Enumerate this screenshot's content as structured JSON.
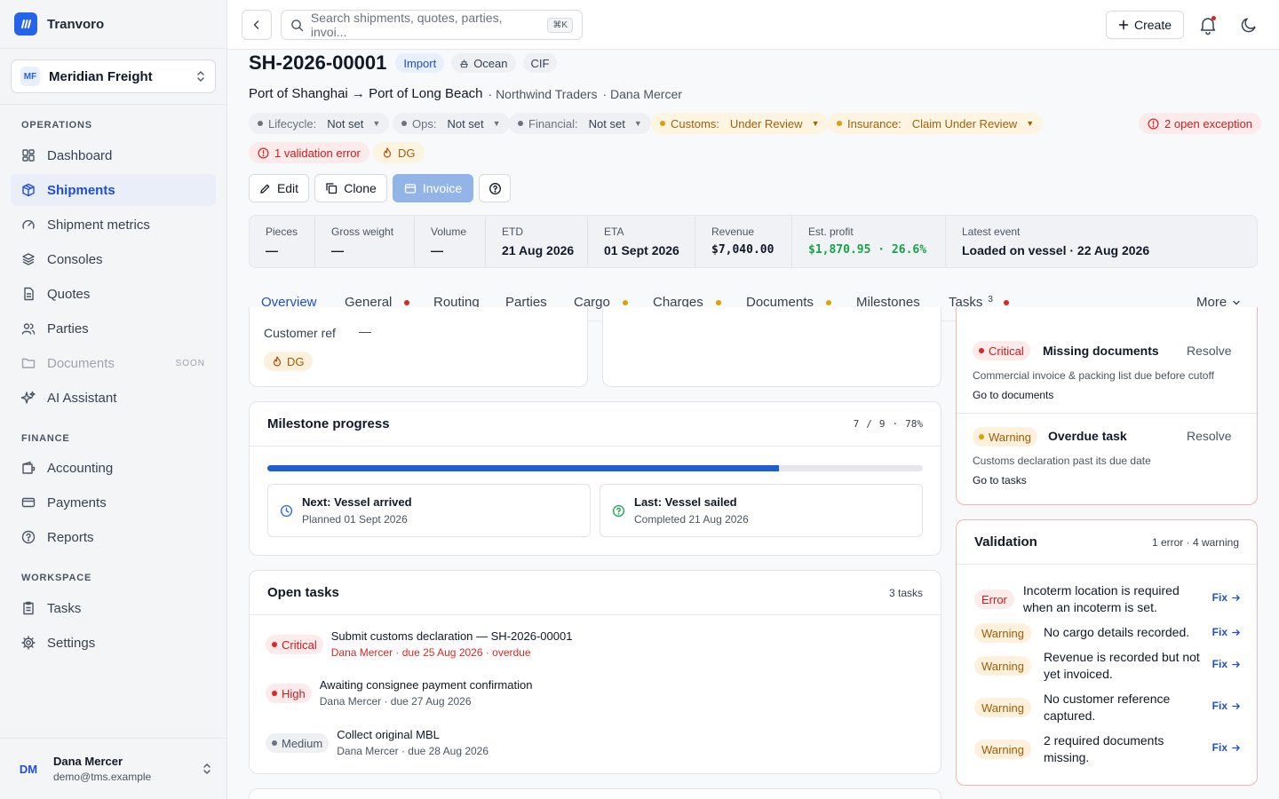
{
  "brand": {
    "name": "Tranvoro"
  },
  "org": {
    "initials": "MF",
    "name": "Meridian Freight"
  },
  "sidebar": {
    "operations_label": "OPERATIONS",
    "finance_label": "FINANCE",
    "workspace_label": "WORKSPACE",
    "items": [
      {
        "label": "Dashboard"
      },
      {
        "label": "Shipments"
      },
      {
        "label": "Shipment metrics"
      },
      {
        "label": "Consoles"
      },
      {
        "label": "Quotes"
      },
      {
        "label": "Parties"
      },
      {
        "label": "Documents",
        "tag": "SOON"
      },
      {
        "label": "AI Assistant"
      },
      {
        "label": "Accounting"
      },
      {
        "label": "Payments"
      },
      {
        "label": "Reports"
      },
      {
        "label": "Tasks"
      },
      {
        "label": "Settings"
      }
    ]
  },
  "user": {
    "initials": "DM",
    "name": "Dana Mercer",
    "email": "demo@tms.example"
  },
  "topbar": {
    "search_placeholder": "Search shipments, quotes, parties, invoi...",
    "shortcut": "⌘K",
    "create_label": "Create"
  },
  "shipment": {
    "id": "SH-2026-00001",
    "direction": "Import",
    "mode": "Ocean",
    "incoterm": "CIF",
    "route": "Port of Shanghai → Port of Long Beach",
    "customer": "· Northwind Traders",
    "owner": "· Dana Mercer",
    "statuses": [
      {
        "label": "Lifecycle:",
        "value": "Not set"
      },
      {
        "label": "Ops:",
        "value": "Not set"
      },
      {
        "label": "Financial:",
        "value": "Not set"
      },
      {
        "label": "Customs:",
        "value": "Under Review"
      },
      {
        "label": "Insurance:",
        "value": "Claim Under Review"
      }
    ],
    "exceptions": "2 open exception",
    "validation_error": "1 validation error",
    "dg": "DG"
  },
  "actions": {
    "edit": "Edit",
    "clone": "Clone",
    "invoice": "Invoice"
  },
  "stats": [
    {
      "label": "Pieces",
      "value": "—"
    },
    {
      "label": "Gross weight",
      "value": "—"
    },
    {
      "label": "Volume",
      "value": "—"
    },
    {
      "label": "ETD",
      "value": "21 Aug 2026"
    },
    {
      "label": "ETA",
      "value": "01 Sept 2026"
    },
    {
      "label": "Revenue",
      "value": "$7,040.00"
    },
    {
      "label": "Est. profit",
      "value": "$1,870.95 · 26.6%"
    },
    {
      "label": "Latest event",
      "value": "Loaded on vessel · 22 Aug 2026"
    }
  ],
  "tabs": [
    {
      "label": "Overview"
    },
    {
      "label": "General"
    },
    {
      "label": "Routing"
    },
    {
      "label": "Parties"
    },
    {
      "label": "Cargo"
    },
    {
      "label": "Charges"
    },
    {
      "label": "Documents"
    },
    {
      "label": "Milestones"
    },
    {
      "label": "Tasks",
      "count": "3"
    },
    {
      "label": "More"
    }
  ],
  "summary": {
    "customer_ref_label": "Customer ref",
    "customer_ref_value": "—",
    "dg": "DG"
  },
  "milestones": {
    "title": "Milestone progress",
    "done": "7",
    "sep": "/",
    "total": "9",
    "dot": "·",
    "percent_label": "78%",
    "progress": 0.78,
    "next_title": "Next: Vessel arrived",
    "next_sub": "Planned 01 Sept 2026",
    "last_title": "Last: Vessel sailed",
    "last_sub": "Completed 21 Aug 2026"
  },
  "tasks": {
    "title": "Open tasks",
    "count": "3 tasks",
    "items": [
      {
        "priority": "Critical",
        "title": "Submit customs declaration — SH-2026-00001",
        "meta": "Dana Mercer · due 25 Aug 2026 · overdue"
      },
      {
        "priority": "High",
        "title": "Awaiting consignee payment confirmation",
        "meta": "Dana Mercer · due 27 Aug 2026"
      },
      {
        "priority": "Medium",
        "title": "Collect original MBL",
        "meta": "Dana Mercer · due 28 Aug 2026"
      }
    ]
  },
  "exceptions": {
    "items": [
      {
        "severity": "Critical",
        "title": "Missing documents",
        "action": "Resolve",
        "desc": "Commercial invoice & packing list due before cutoff",
        "link": "Go to documents"
      },
      {
        "severity": "Warning",
        "title": "Overdue task",
        "action": "Resolve",
        "desc": "Customs declaration past its due date",
        "link": "Go to tasks"
      }
    ]
  },
  "validation": {
    "title": "Validation",
    "summary": "1 error · 4 warning",
    "fix_label": "Fix",
    "items": [
      {
        "level": "Error",
        "text": "Incoterm location is required when an incoterm is set."
      },
      {
        "level": "Warning",
        "text": "No cargo details recorded."
      },
      {
        "level": "Warning",
        "text": "Revenue is recorded but not yet invoiced."
      },
      {
        "level": "Warning",
        "text": "No customer reference captured."
      },
      {
        "level": "Warning",
        "text": "2 required documents missing."
      }
    ]
  }
}
